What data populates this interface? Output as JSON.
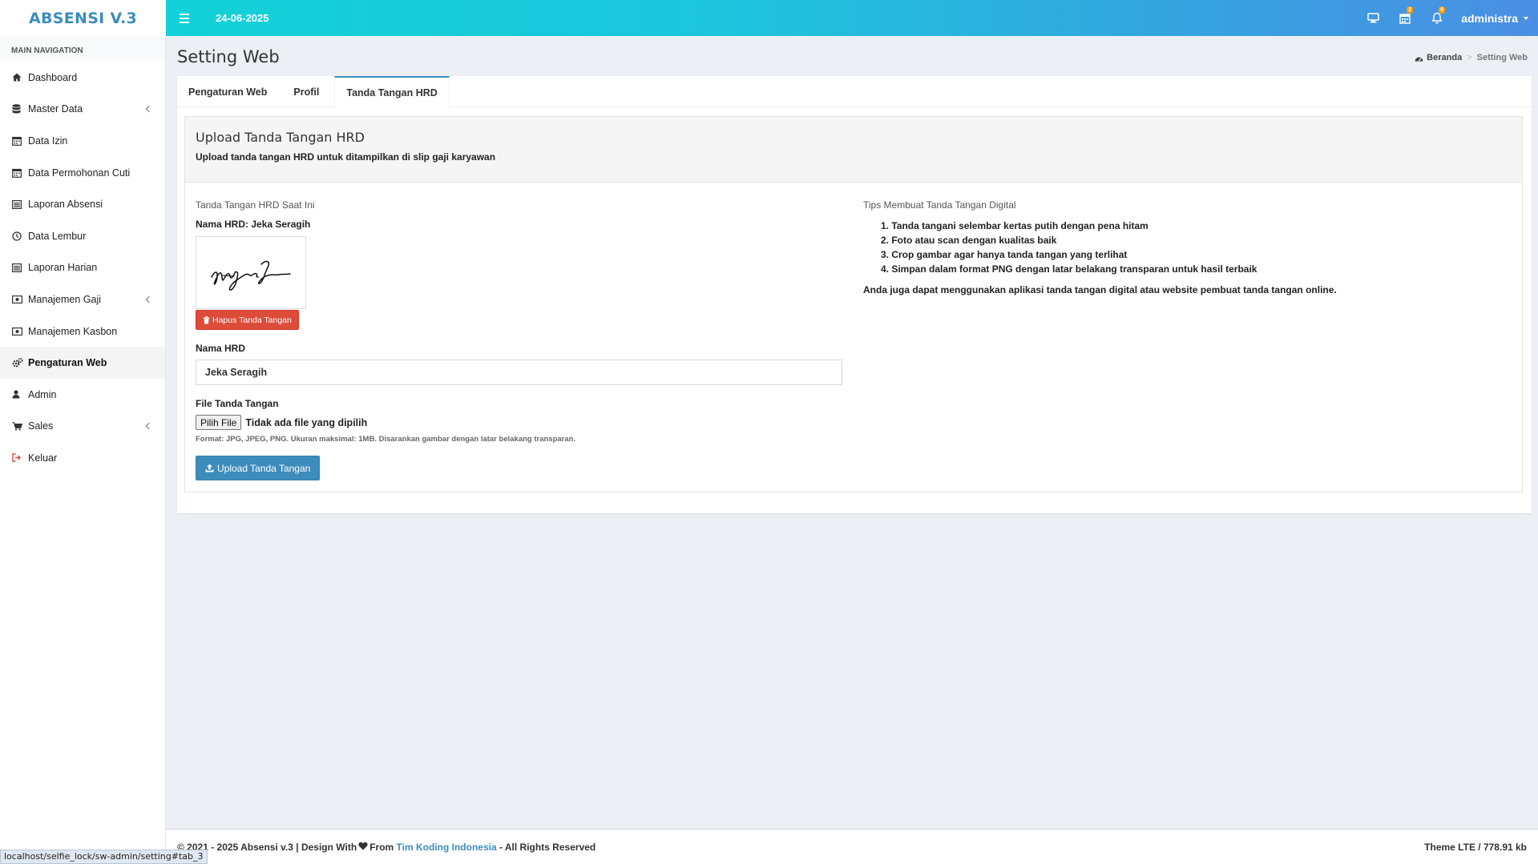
{
  "app": {
    "logo": "ABSENSI V.3",
    "date": "24-06-2025"
  },
  "topbar": {
    "icons": [
      {
        "name": "desktop-icon",
        "badge": ""
      },
      {
        "name": "calendar-icon",
        "badge": "2"
      },
      {
        "name": "bell-icon",
        "badge": "0"
      }
    ],
    "user": "administra"
  },
  "sidebar": {
    "header": "MAIN NAVIGATION",
    "items": [
      {
        "label": "Dashboard",
        "icon": "home-icon",
        "has_children": false,
        "active": false
      },
      {
        "label": "Master Data",
        "icon": "database-icon",
        "has_children": true,
        "active": false
      },
      {
        "label": "Data Izin",
        "icon": "calendar-icon",
        "has_children": false,
        "active": false
      },
      {
        "label": "Data Permohonan Cuti",
        "icon": "calendar-icon",
        "has_children": false,
        "active": false
      },
      {
        "label": "Laporan Absensi",
        "icon": "list-alt-icon",
        "has_children": false,
        "active": false
      },
      {
        "label": "Data Lembur",
        "icon": "clock-icon",
        "has_children": false,
        "active": false
      },
      {
        "label": "Laporan Harian",
        "icon": "list-alt-icon",
        "has_children": false,
        "active": false
      },
      {
        "label": "Manajemen Gaji",
        "icon": "money-icon",
        "has_children": true,
        "active": false
      },
      {
        "label": "Manajemen Kasbon",
        "icon": "money-icon",
        "has_children": false,
        "active": false
      },
      {
        "label": "Pengaturan Web",
        "icon": "cogs-icon",
        "has_children": false,
        "active": true
      },
      {
        "label": "Admin",
        "icon": "user-icon",
        "has_children": false,
        "active": false
      },
      {
        "label": "Sales",
        "icon": "cart-icon",
        "has_children": true,
        "active": false
      },
      {
        "label": "Keluar",
        "icon": "sign-out-icon",
        "has_children": false,
        "active": false
      }
    ]
  },
  "page": {
    "title": "Setting Web",
    "breadcrumb": {
      "home": "Beranda",
      "current": "Setting Web"
    }
  },
  "tabs": [
    {
      "label": "Pengaturan Web",
      "active": false
    },
    {
      "label": "Profil",
      "active": false
    },
    {
      "label": "Tanda Tangan HRD",
      "active": true
    }
  ],
  "signature_box": {
    "title": "Upload Tanda Tangan HRD",
    "subtitle": "Upload tanda tangan HRD untuk ditampilkan di slip gaji karyawan",
    "current_label": "Tanda Tangan HRD Saat Ini",
    "hrd_name_line": "Nama HRD: Jeka Seragih",
    "delete_button": "Hapus Tanda Tangan",
    "name_field_label": "Nama HRD",
    "name_field_value": "Jeka Seragih",
    "file_field_label": "File Tanda Tangan",
    "file_button": "Pilih File",
    "file_status": "Tidak ada file yang dipilih",
    "file_help": "Format: JPG, JPEG, PNG. Ukuran maksimal: 1MB. Disarankan gambar dengan latar belakang transparan.",
    "upload_button": "Upload Tanda Tangan"
  },
  "tips": {
    "title": "Tips Membuat Tanda Tangan Digital",
    "items": [
      "1. Tanda tangani selembar kertas putih dengan pena hitam",
      "2. Foto atau scan dengan kualitas baik",
      "3. Crop gambar agar hanya tanda tangan yang terlihat",
      "4. Simpan dalam format PNG dengan latar belakang transparan untuk hasil terbaik"
    ],
    "note": "Anda juga dapat menggunakan aplikasi tanda tangan digital atau website pembuat tanda tangan online."
  },
  "footer": {
    "left_prefix": "© 2021 - 2025 Absensi v.3 | Design With",
    "left_from": "From",
    "link": "Tim Koding Indonesia",
    "left_suffix": "- All Rights Reserved",
    "right": "Theme LTE / 778.91 kb"
  },
  "statusbar": {
    "url": "localhost/selfie_lock/sw-admin/setting#tab_3"
  },
  "colors": {
    "accent": "#3c8dbc",
    "danger": "#dd4b39",
    "topbar_start": "#12d1d8",
    "topbar_end": "#4a8fe3"
  }
}
